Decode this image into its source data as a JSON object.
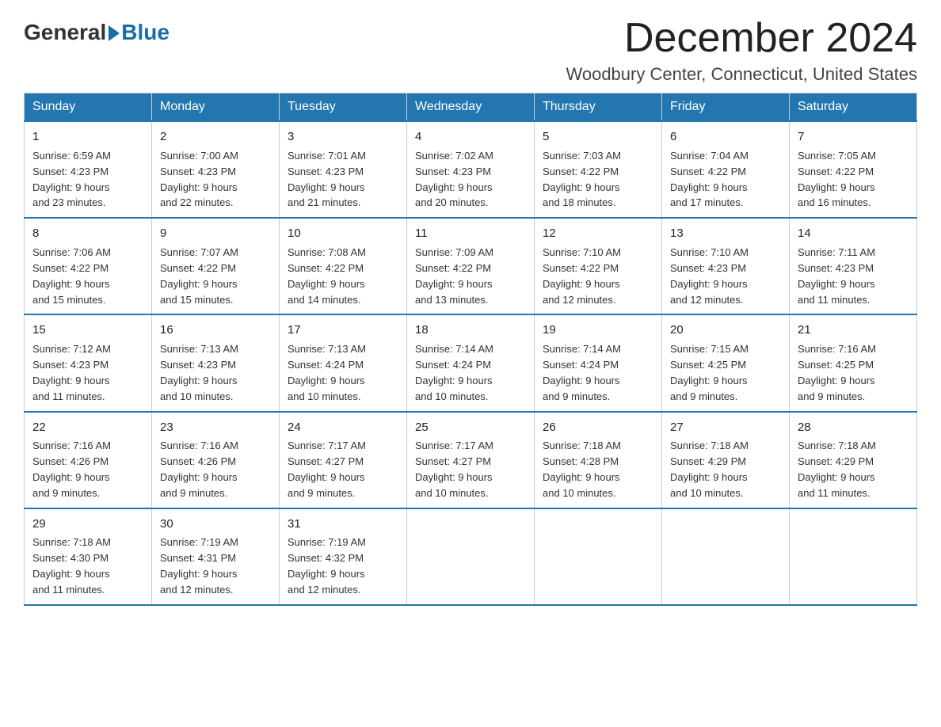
{
  "header": {
    "logo": {
      "general": "General",
      "blue": "Blue"
    },
    "month": "December 2024",
    "location": "Woodbury Center, Connecticut, United States"
  },
  "days_of_week": [
    "Sunday",
    "Monday",
    "Tuesday",
    "Wednesday",
    "Thursday",
    "Friday",
    "Saturday"
  ],
  "weeks": [
    [
      {
        "day": "1",
        "sunrise": "6:59 AM",
        "sunset": "4:23 PM",
        "daylight": "9 hours and 23 minutes."
      },
      {
        "day": "2",
        "sunrise": "7:00 AM",
        "sunset": "4:23 PM",
        "daylight": "9 hours and 22 minutes."
      },
      {
        "day": "3",
        "sunrise": "7:01 AM",
        "sunset": "4:23 PM",
        "daylight": "9 hours and 21 minutes."
      },
      {
        "day": "4",
        "sunrise": "7:02 AM",
        "sunset": "4:23 PM",
        "daylight": "9 hours and 20 minutes."
      },
      {
        "day": "5",
        "sunrise": "7:03 AM",
        "sunset": "4:22 PM",
        "daylight": "9 hours and 18 minutes."
      },
      {
        "day": "6",
        "sunrise": "7:04 AM",
        "sunset": "4:22 PM",
        "daylight": "9 hours and 17 minutes."
      },
      {
        "day": "7",
        "sunrise": "7:05 AM",
        "sunset": "4:22 PM",
        "daylight": "9 hours and 16 minutes."
      }
    ],
    [
      {
        "day": "8",
        "sunrise": "7:06 AM",
        "sunset": "4:22 PM",
        "daylight": "9 hours and 15 minutes."
      },
      {
        "day": "9",
        "sunrise": "7:07 AM",
        "sunset": "4:22 PM",
        "daylight": "9 hours and 15 minutes."
      },
      {
        "day": "10",
        "sunrise": "7:08 AM",
        "sunset": "4:22 PM",
        "daylight": "9 hours and 14 minutes."
      },
      {
        "day": "11",
        "sunrise": "7:09 AM",
        "sunset": "4:22 PM",
        "daylight": "9 hours and 13 minutes."
      },
      {
        "day": "12",
        "sunrise": "7:10 AM",
        "sunset": "4:22 PM",
        "daylight": "9 hours and 12 minutes."
      },
      {
        "day": "13",
        "sunrise": "7:10 AM",
        "sunset": "4:23 PM",
        "daylight": "9 hours and 12 minutes."
      },
      {
        "day": "14",
        "sunrise": "7:11 AM",
        "sunset": "4:23 PM",
        "daylight": "9 hours and 11 minutes."
      }
    ],
    [
      {
        "day": "15",
        "sunrise": "7:12 AM",
        "sunset": "4:23 PM",
        "daylight": "9 hours and 11 minutes."
      },
      {
        "day": "16",
        "sunrise": "7:13 AM",
        "sunset": "4:23 PM",
        "daylight": "9 hours and 10 minutes."
      },
      {
        "day": "17",
        "sunrise": "7:13 AM",
        "sunset": "4:24 PM",
        "daylight": "9 hours and 10 minutes."
      },
      {
        "day": "18",
        "sunrise": "7:14 AM",
        "sunset": "4:24 PM",
        "daylight": "9 hours and 10 minutes."
      },
      {
        "day": "19",
        "sunrise": "7:14 AM",
        "sunset": "4:24 PM",
        "daylight": "9 hours and 9 minutes."
      },
      {
        "day": "20",
        "sunrise": "7:15 AM",
        "sunset": "4:25 PM",
        "daylight": "9 hours and 9 minutes."
      },
      {
        "day": "21",
        "sunrise": "7:16 AM",
        "sunset": "4:25 PM",
        "daylight": "9 hours and 9 minutes."
      }
    ],
    [
      {
        "day": "22",
        "sunrise": "7:16 AM",
        "sunset": "4:26 PM",
        "daylight": "9 hours and 9 minutes."
      },
      {
        "day": "23",
        "sunrise": "7:16 AM",
        "sunset": "4:26 PM",
        "daylight": "9 hours and 9 minutes."
      },
      {
        "day": "24",
        "sunrise": "7:17 AM",
        "sunset": "4:27 PM",
        "daylight": "9 hours and 9 minutes."
      },
      {
        "day": "25",
        "sunrise": "7:17 AM",
        "sunset": "4:27 PM",
        "daylight": "9 hours and 10 minutes."
      },
      {
        "day": "26",
        "sunrise": "7:18 AM",
        "sunset": "4:28 PM",
        "daylight": "9 hours and 10 minutes."
      },
      {
        "day": "27",
        "sunrise": "7:18 AM",
        "sunset": "4:29 PM",
        "daylight": "9 hours and 10 minutes."
      },
      {
        "day": "28",
        "sunrise": "7:18 AM",
        "sunset": "4:29 PM",
        "daylight": "9 hours and 11 minutes."
      }
    ],
    [
      {
        "day": "29",
        "sunrise": "7:18 AM",
        "sunset": "4:30 PM",
        "daylight": "9 hours and 11 minutes."
      },
      {
        "day": "30",
        "sunrise": "7:19 AM",
        "sunset": "4:31 PM",
        "daylight": "9 hours and 12 minutes."
      },
      {
        "day": "31",
        "sunrise": "7:19 AM",
        "sunset": "4:32 PM",
        "daylight": "9 hours and 12 minutes."
      },
      null,
      null,
      null,
      null
    ]
  ],
  "labels": {
    "sunrise": "Sunrise:",
    "sunset": "Sunset:",
    "daylight": "Daylight:"
  }
}
